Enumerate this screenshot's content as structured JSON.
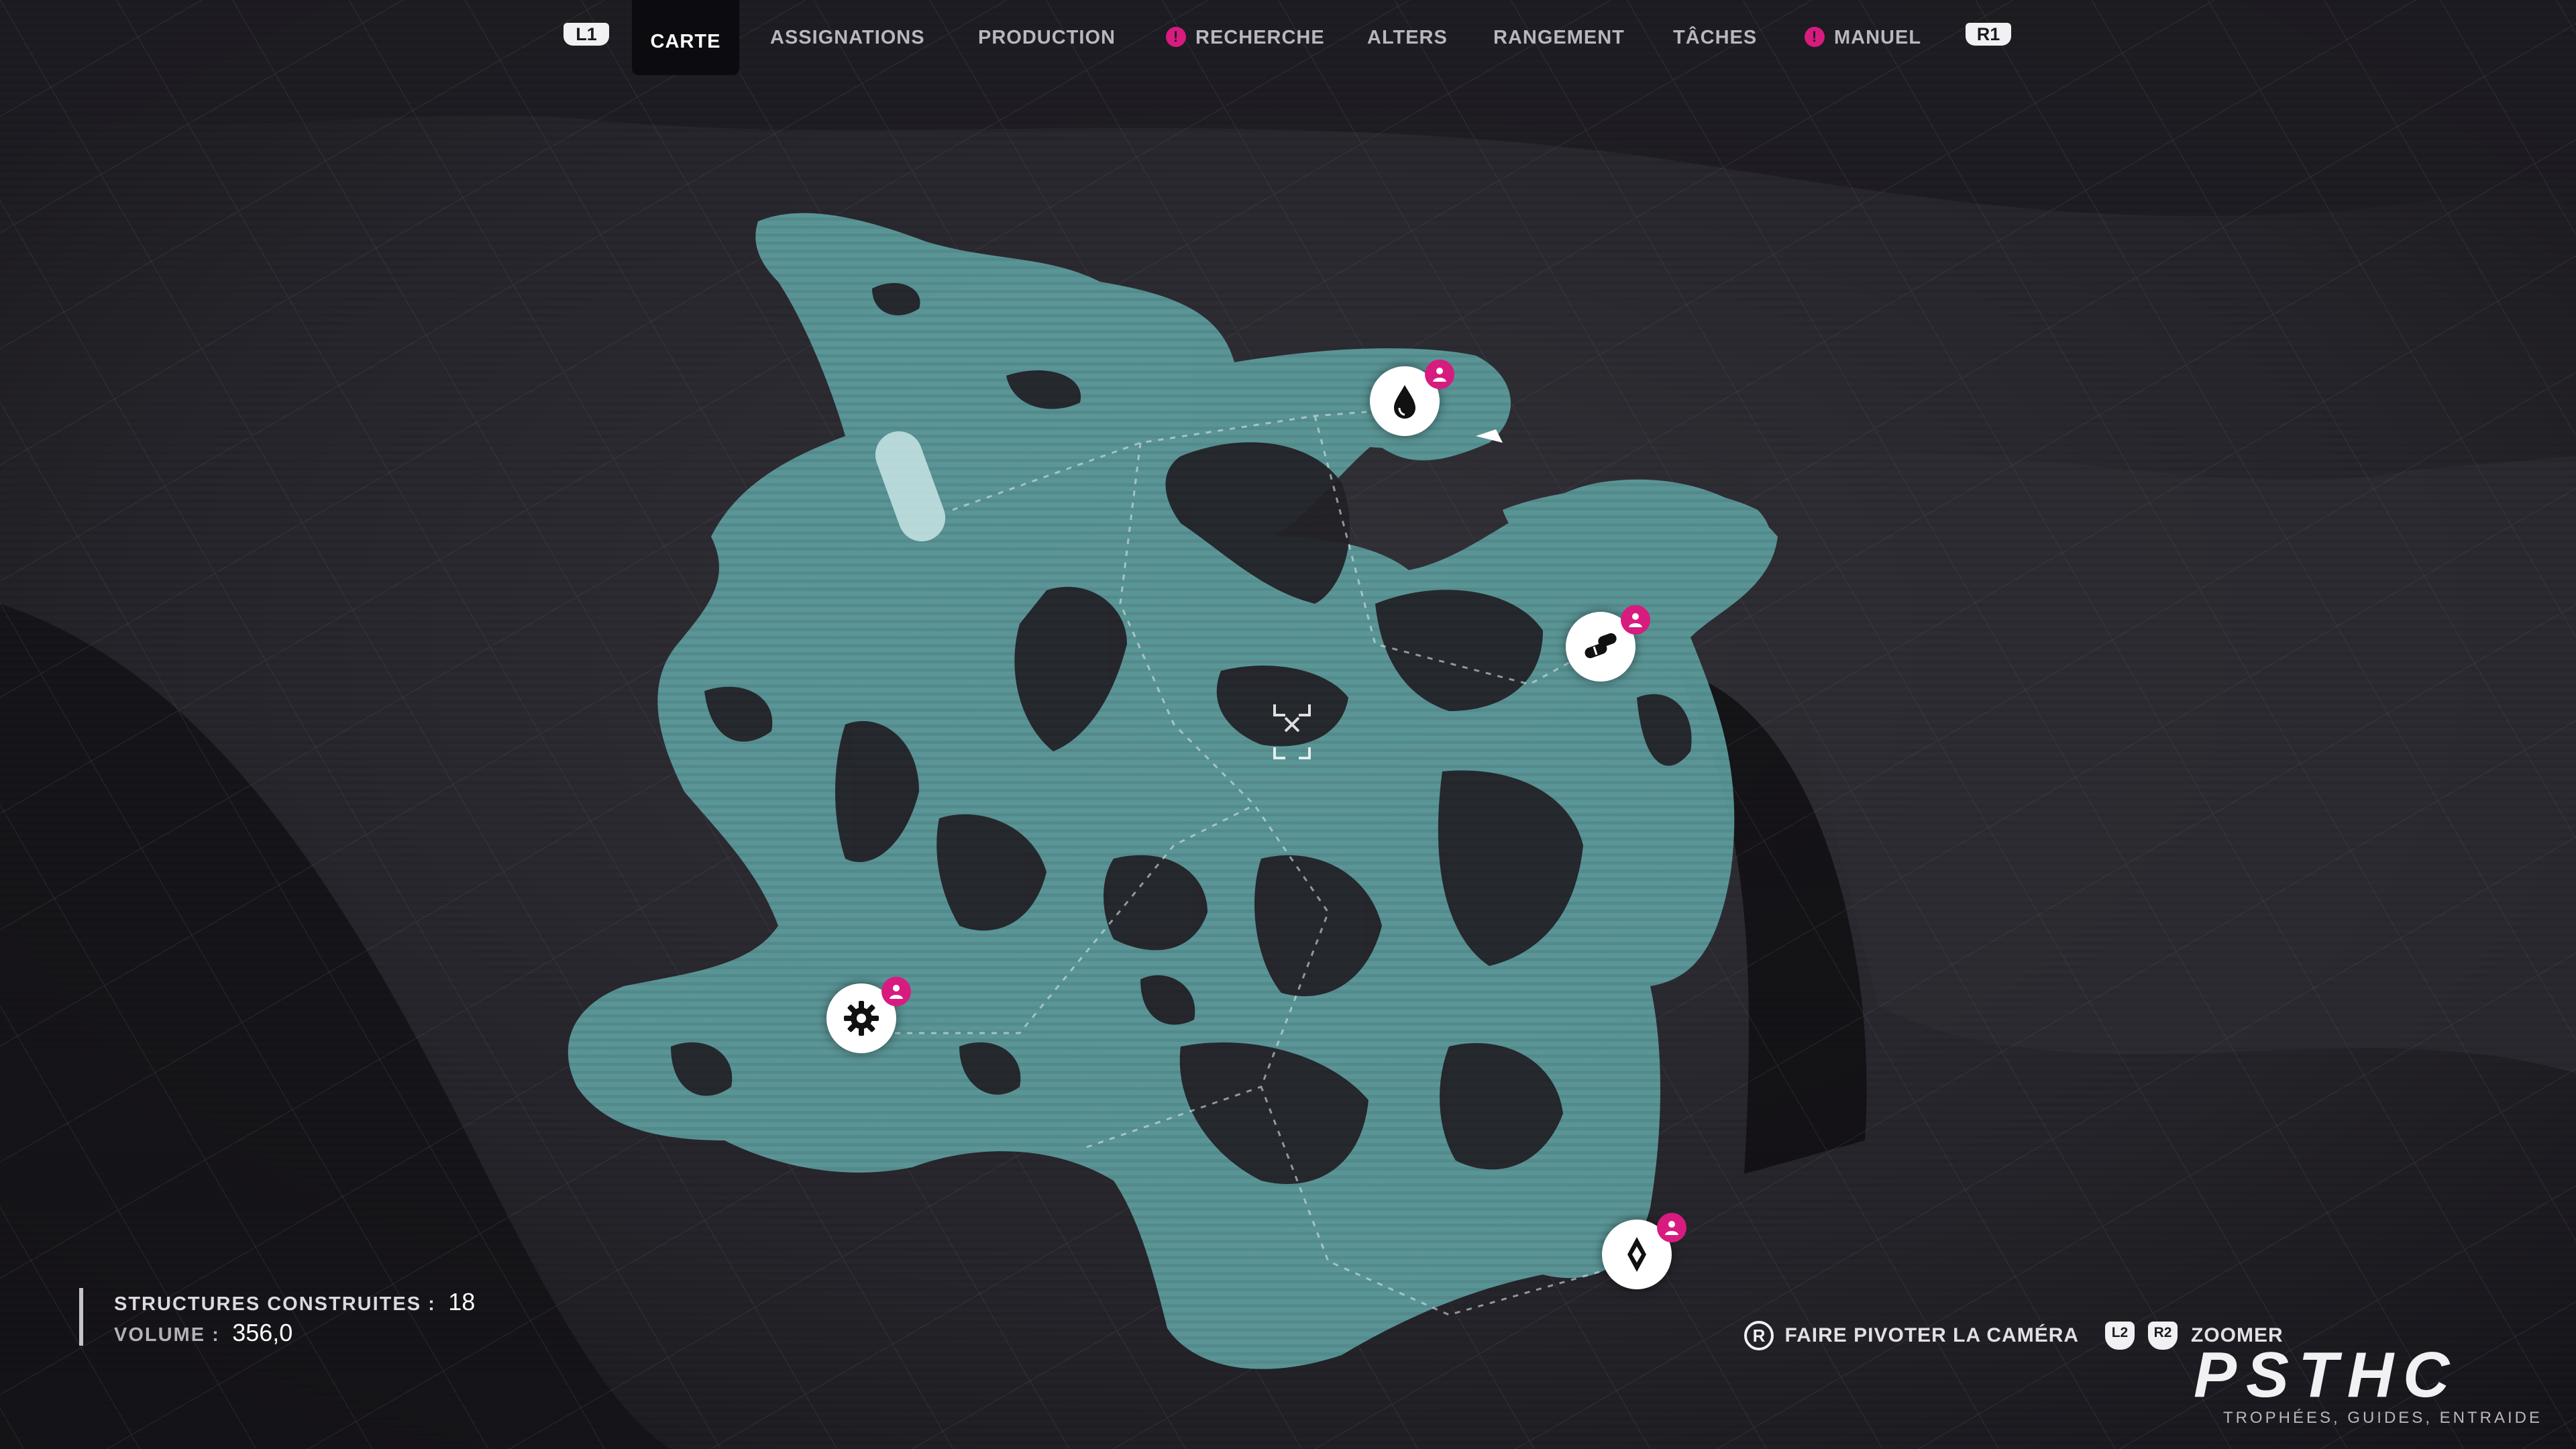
{
  "nav": {
    "left_button": "L1",
    "right_button": "R1",
    "tabs": [
      {
        "label": "CARTE",
        "active": true,
        "alert": false
      },
      {
        "label": "ASSIGNATIONS",
        "active": false,
        "alert": false
      },
      {
        "label": "PRODUCTION",
        "active": false,
        "alert": false
      },
      {
        "label": "RECHERCHE",
        "active": false,
        "alert": true
      },
      {
        "label": "ALTERS",
        "active": false,
        "alert": false
      },
      {
        "label": "RANGEMENT",
        "active": false,
        "alert": false
      },
      {
        "label": "TÂCHES",
        "active": false,
        "alert": false
      },
      {
        "label": "MANUEL",
        "active": false,
        "alert": true
      }
    ],
    "alert_glyph": "!"
  },
  "map": {
    "markers": [
      {
        "icon": "water-drop-icon",
        "badge": "person-badge-icon"
      },
      {
        "icon": "pills-icon",
        "badge": "person-badge-icon"
      },
      {
        "icon": "gear-icon",
        "badge": "person-badge-icon"
      },
      {
        "icon": "crystal-icon",
        "badge": "person-badge-icon"
      }
    ],
    "cursor": "crosshair-icon",
    "colors": {
      "explored_area": "#5e9e9f",
      "background": "#1b1a1f",
      "accent": "#d81b7f"
    }
  },
  "stats": {
    "structures_label": "STRUCTURES CONSTRUITES :",
    "structures_value": "18",
    "volume_label": "VOLUME :",
    "volume_value": "356,0"
  },
  "hints": {
    "rotate_button": "R",
    "rotate_label": "FAIRE PIVOTER LA CAMÉRA",
    "zoom_button_left": "L2",
    "zoom_button_right": "R2",
    "zoom_label": "ZOOMER"
  },
  "watermark": {
    "logo_text": "PSTHC",
    "tagline": "TROPHÉES, GUIDES, ENTRAIDE"
  }
}
